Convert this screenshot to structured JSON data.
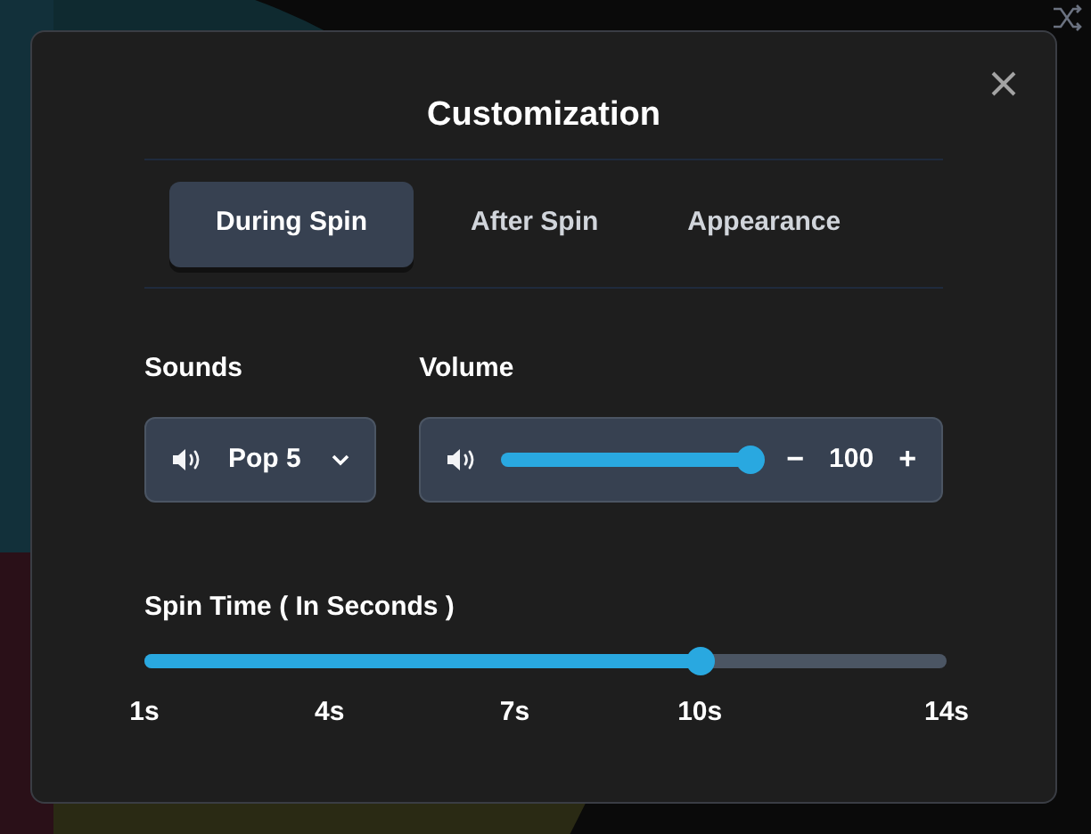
{
  "dialog": {
    "title": "Customization",
    "tabs": [
      {
        "label": "During Spin",
        "selected": true
      },
      {
        "label": "After Spin",
        "selected": false
      },
      {
        "label": "Appearance",
        "selected": false
      }
    ],
    "sounds": {
      "label": "Sounds",
      "value": "Pop 5"
    },
    "volume": {
      "label": "Volume",
      "level": 1,
      "value": "100",
      "decrement": "−",
      "increment": "+"
    },
    "spin_time": {
      "label": "Spin Time ( In Seconds )",
      "level": 0.693,
      "ticks": [
        "1s",
        "4s",
        "7s",
        "10s",
        "14s"
      ]
    }
  }
}
